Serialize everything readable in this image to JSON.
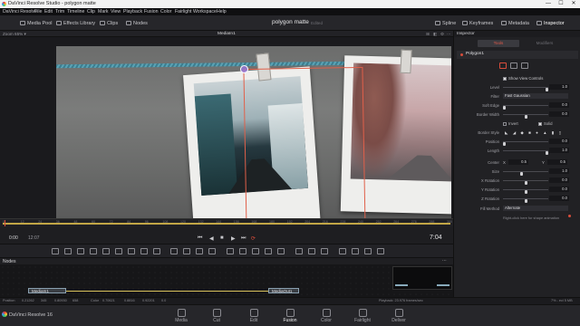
{
  "window": {
    "title": "DaVinci Resolve Studio - polygon matte",
    "minimize": "—",
    "maximize": "☐",
    "close": "✕"
  },
  "menu": [
    "DaVinci Resolve",
    "File",
    "Edit",
    "Trim",
    "Timeline",
    "Clip",
    "Mark",
    "View",
    "Playback",
    "Fusion",
    "Color",
    "Fairlight",
    "Workspace",
    "Help"
  ],
  "toolbar": {
    "media_pool": "Media Pool",
    "effects_library": "Effects Library",
    "clips": "Clips",
    "nodes": "Nodes",
    "project_title": "polygon matte",
    "project_status": "Edited",
    "spline": "Spline",
    "keyframes": "Keyframes",
    "metadata": "Metadata",
    "inspector": "Inspector"
  },
  "viewer": {
    "zoom": "Zoom 65% ▾",
    "clip_name": "MediaIn1",
    "icons": [
      "⊞",
      "◧",
      "⚙",
      "⋯"
    ]
  },
  "ruler": {
    "ticks": [
      "0",
      "12",
      "24",
      "36",
      "48",
      "60",
      "72",
      "84",
      "96",
      "108",
      "120",
      "132",
      "144",
      "156",
      "168",
      "180",
      "192",
      "204",
      "216",
      "228",
      "240",
      "252",
      "264",
      "276",
      "288",
      "300"
    ]
  },
  "transport": {
    "current_start": "0:00",
    "end": "12:07",
    "current": "7:04",
    "buttons": [
      "⏮",
      "◀",
      "■",
      "▶",
      "⏭",
      "⟳"
    ]
  },
  "nodes": {
    "panel_label": "Nodes",
    "media_in": "MediaIn1",
    "media_out": "MediaOut1",
    "more": "⋯"
  },
  "statusbar": {
    "position_label": "Position",
    "pos_x": "0.21262",
    "pos_y": "345",
    "pos_z": "0.80930",
    "frame": "658",
    "color_label": "Color",
    "r": "0.70621",
    "g": "0.8816",
    "b": "0.92201",
    "a": "0.0",
    "playback": "Playback: 23.976 frames/sec",
    "memory": "7% - ecl 5 MB"
  },
  "pages": [
    "Media",
    "Cut",
    "Edit",
    "Fusion",
    "Color",
    "Fairlight",
    "Deliver"
  ],
  "active_page": "Fusion",
  "app_name": "DaVinci Resolve 16",
  "inspector": {
    "title": "Inspector",
    "tabs": [
      "Tools",
      "Modifiers"
    ],
    "node_name": "Polygon1",
    "show_view_controls": "Show View Controls",
    "level": {
      "label": "Level",
      "value": "1.0",
      "fraction": 1.0
    },
    "filter": {
      "label": "Filter",
      "value": "Fast Gaussian"
    },
    "soft_edge": {
      "label": "Soft Edge",
      "value": "0.0",
      "fraction": 0.0
    },
    "border_width": {
      "label": "Border Width",
      "value": "0.0",
      "fraction": 0.5
    },
    "invert_label": "Invert",
    "solid_label": "Solid",
    "border_style": {
      "label": "Border Style"
    },
    "position": {
      "label": "Position",
      "value": "0.0",
      "fraction": 0.0
    },
    "length": {
      "label": "Length",
      "value": "1.0",
      "fraction": 1.0
    },
    "center": {
      "label": "Center",
      "x_label": "X",
      "x": "0.5",
      "y_label": "Y",
      "y": "0.5"
    },
    "size": {
      "label": "Size",
      "value": "1.0",
      "fraction": 0.4
    },
    "x_rotation": {
      "label": "X Rotation",
      "value": "0.0",
      "fraction": 0.5
    },
    "y_rotation": {
      "label": "Y Rotation",
      "value": "0.0",
      "fraction": 0.5
    },
    "z_rotation": {
      "label": "Z Rotation",
      "value": "0.0",
      "fraction": 0.5
    },
    "fill_method": {
      "label": "Fill Method",
      "value": "Alternate"
    },
    "hint": "Right-click here for shape animation"
  },
  "colors": {
    "accent": "#d94d3b",
    "timeline_track": "#c2a646",
    "rope": "#4a93a6"
  }
}
